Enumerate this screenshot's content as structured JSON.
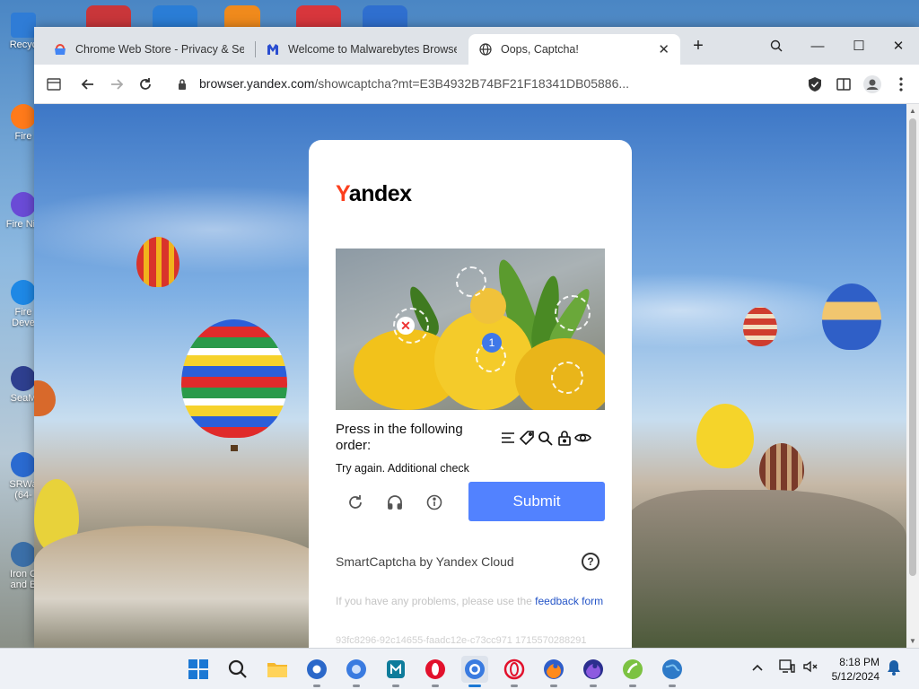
{
  "desktop": {
    "icons": [
      {
        "label": "Recyc",
        "color": "#2f7cd6"
      },
      {
        "label": "Fire",
        "color": "#ff7a1a"
      },
      {
        "label": "Fire Nig",
        "color": "#6a4bd6"
      },
      {
        "label": "Fire Deve",
        "color": "#1e88e5"
      },
      {
        "label": "SeaM",
        "color": "#2e3f8f"
      },
      {
        "label": "SRWa (64-",
        "color": "#2a6ad0"
      },
      {
        "label": "Iron C and B",
        "color": "#3b6fa8"
      }
    ]
  },
  "browser": {
    "tabs": [
      {
        "title": "Chrome Web Store - Privacy & Secu",
        "icon": "chrome-web-store-icon",
        "active": false
      },
      {
        "title": "Welcome to Malwarebytes Browser",
        "icon": "malwarebytes-icon",
        "active": false
      },
      {
        "title": "Oops, Captcha!",
        "icon": "globe-icon",
        "active": true
      }
    ],
    "new_tab_label": "+",
    "close_tab_label": "✕",
    "window_controls": {
      "search": "⌕",
      "minimize": "—",
      "maximize": "☐",
      "close": "✕"
    },
    "address": {
      "host": "browser.yandex.com",
      "path": "/showcaptcha?mt=E3B4932B74BF21F18341DB05886..."
    }
  },
  "captcha": {
    "brand": {
      "y": "Y",
      "rest": "andex"
    },
    "badge_number": "1",
    "instruction": "Press in the following order:",
    "order_icons": [
      "lines-icon",
      "tag-icon",
      "magnifier-icon",
      "padlock-icon",
      "eye-icon"
    ],
    "status": "Try again. Additional check",
    "submit_label": "Submit",
    "provider": "SmartCaptcha by Yandex Cloud",
    "help_label": "?",
    "problems_text": "If you have any problems, please use the ",
    "problems_link": "feedback form",
    "request_id": "93fc8296-92c14655-faadc12e-c73cc971 1715570288291",
    "colors": {
      "submit": "#5282ff",
      "brand_red": "#fc3f1d",
      "link": "#2454c7"
    }
  },
  "taskbar": {
    "apps": [
      "windows-start-icon",
      "search-icon",
      "file-explorer-icon",
      "chromium-icon",
      "chrome-icon",
      "imazing-icon",
      "opera-icon",
      "yandex-browser-icon",
      "opera-gx-icon",
      "firefox-icon",
      "firefox-nightly-icon",
      "coccoc-icon",
      "globe-browser-icon"
    ],
    "clock": {
      "time": "8:18 PM",
      "date": "5/12/2024"
    }
  }
}
